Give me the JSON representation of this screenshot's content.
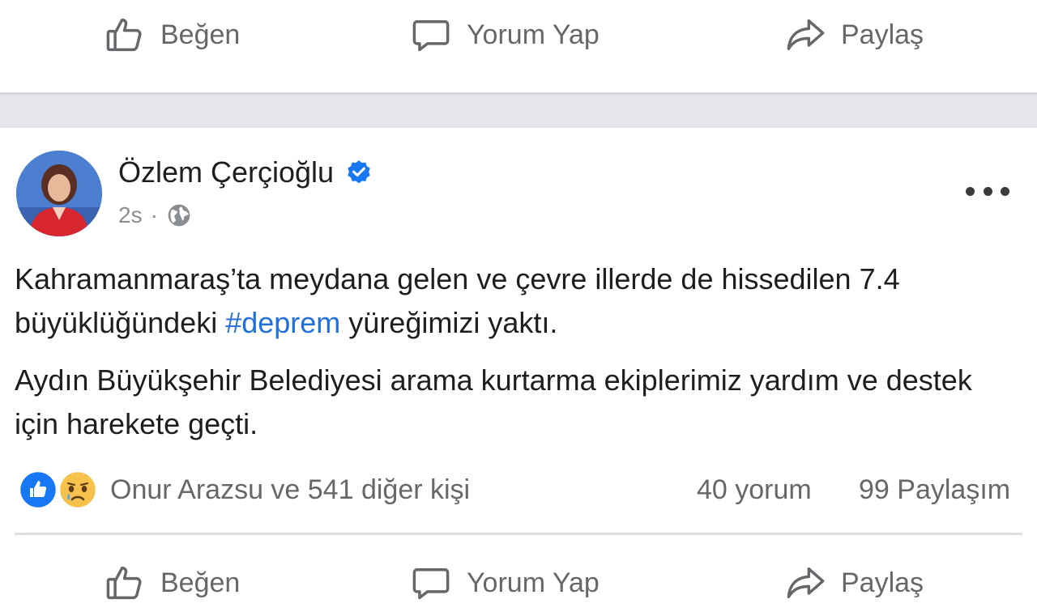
{
  "top_actions": {
    "like": "Beğen",
    "comment": "Yorum Yap",
    "share": "Paylaş"
  },
  "post": {
    "author": "Özlem Çerçioğlu",
    "time": "2s",
    "paragraph1_before": "Kahramanmaraş’ta meydana gelen ve çevre illerde de hissedilen 7.4 büyüklüğündeki ",
    "hashtag": "#deprem",
    "paragraph1_after": " yüreğimizi yaktı.",
    "paragraph2": "Aydın Büyükşehir Belediyesi arama kurtarma ekiplerimiz yardım ve destek için harekete geçti.",
    "reactions_text": "Onur Arazsu ve 541 diğer kişi",
    "comments_count": "40 yorum",
    "shares_count": "99 Paylaşım"
  },
  "bottom_actions": {
    "like": "Beğen",
    "comment": "Yorum Yap",
    "share": "Paylaş"
  },
  "colors": {
    "link": "#216fdb",
    "verified": "#1877f2",
    "like_blue": "#1877f2",
    "secondary_text": "#65676b"
  },
  "icons": [
    "thumbs-up-icon",
    "comment-bubble-icon",
    "share-arrow-icon",
    "verified-badge-icon",
    "globe-icon",
    "more-options-icon",
    "like-reaction-icon",
    "sad-reaction-icon"
  ]
}
